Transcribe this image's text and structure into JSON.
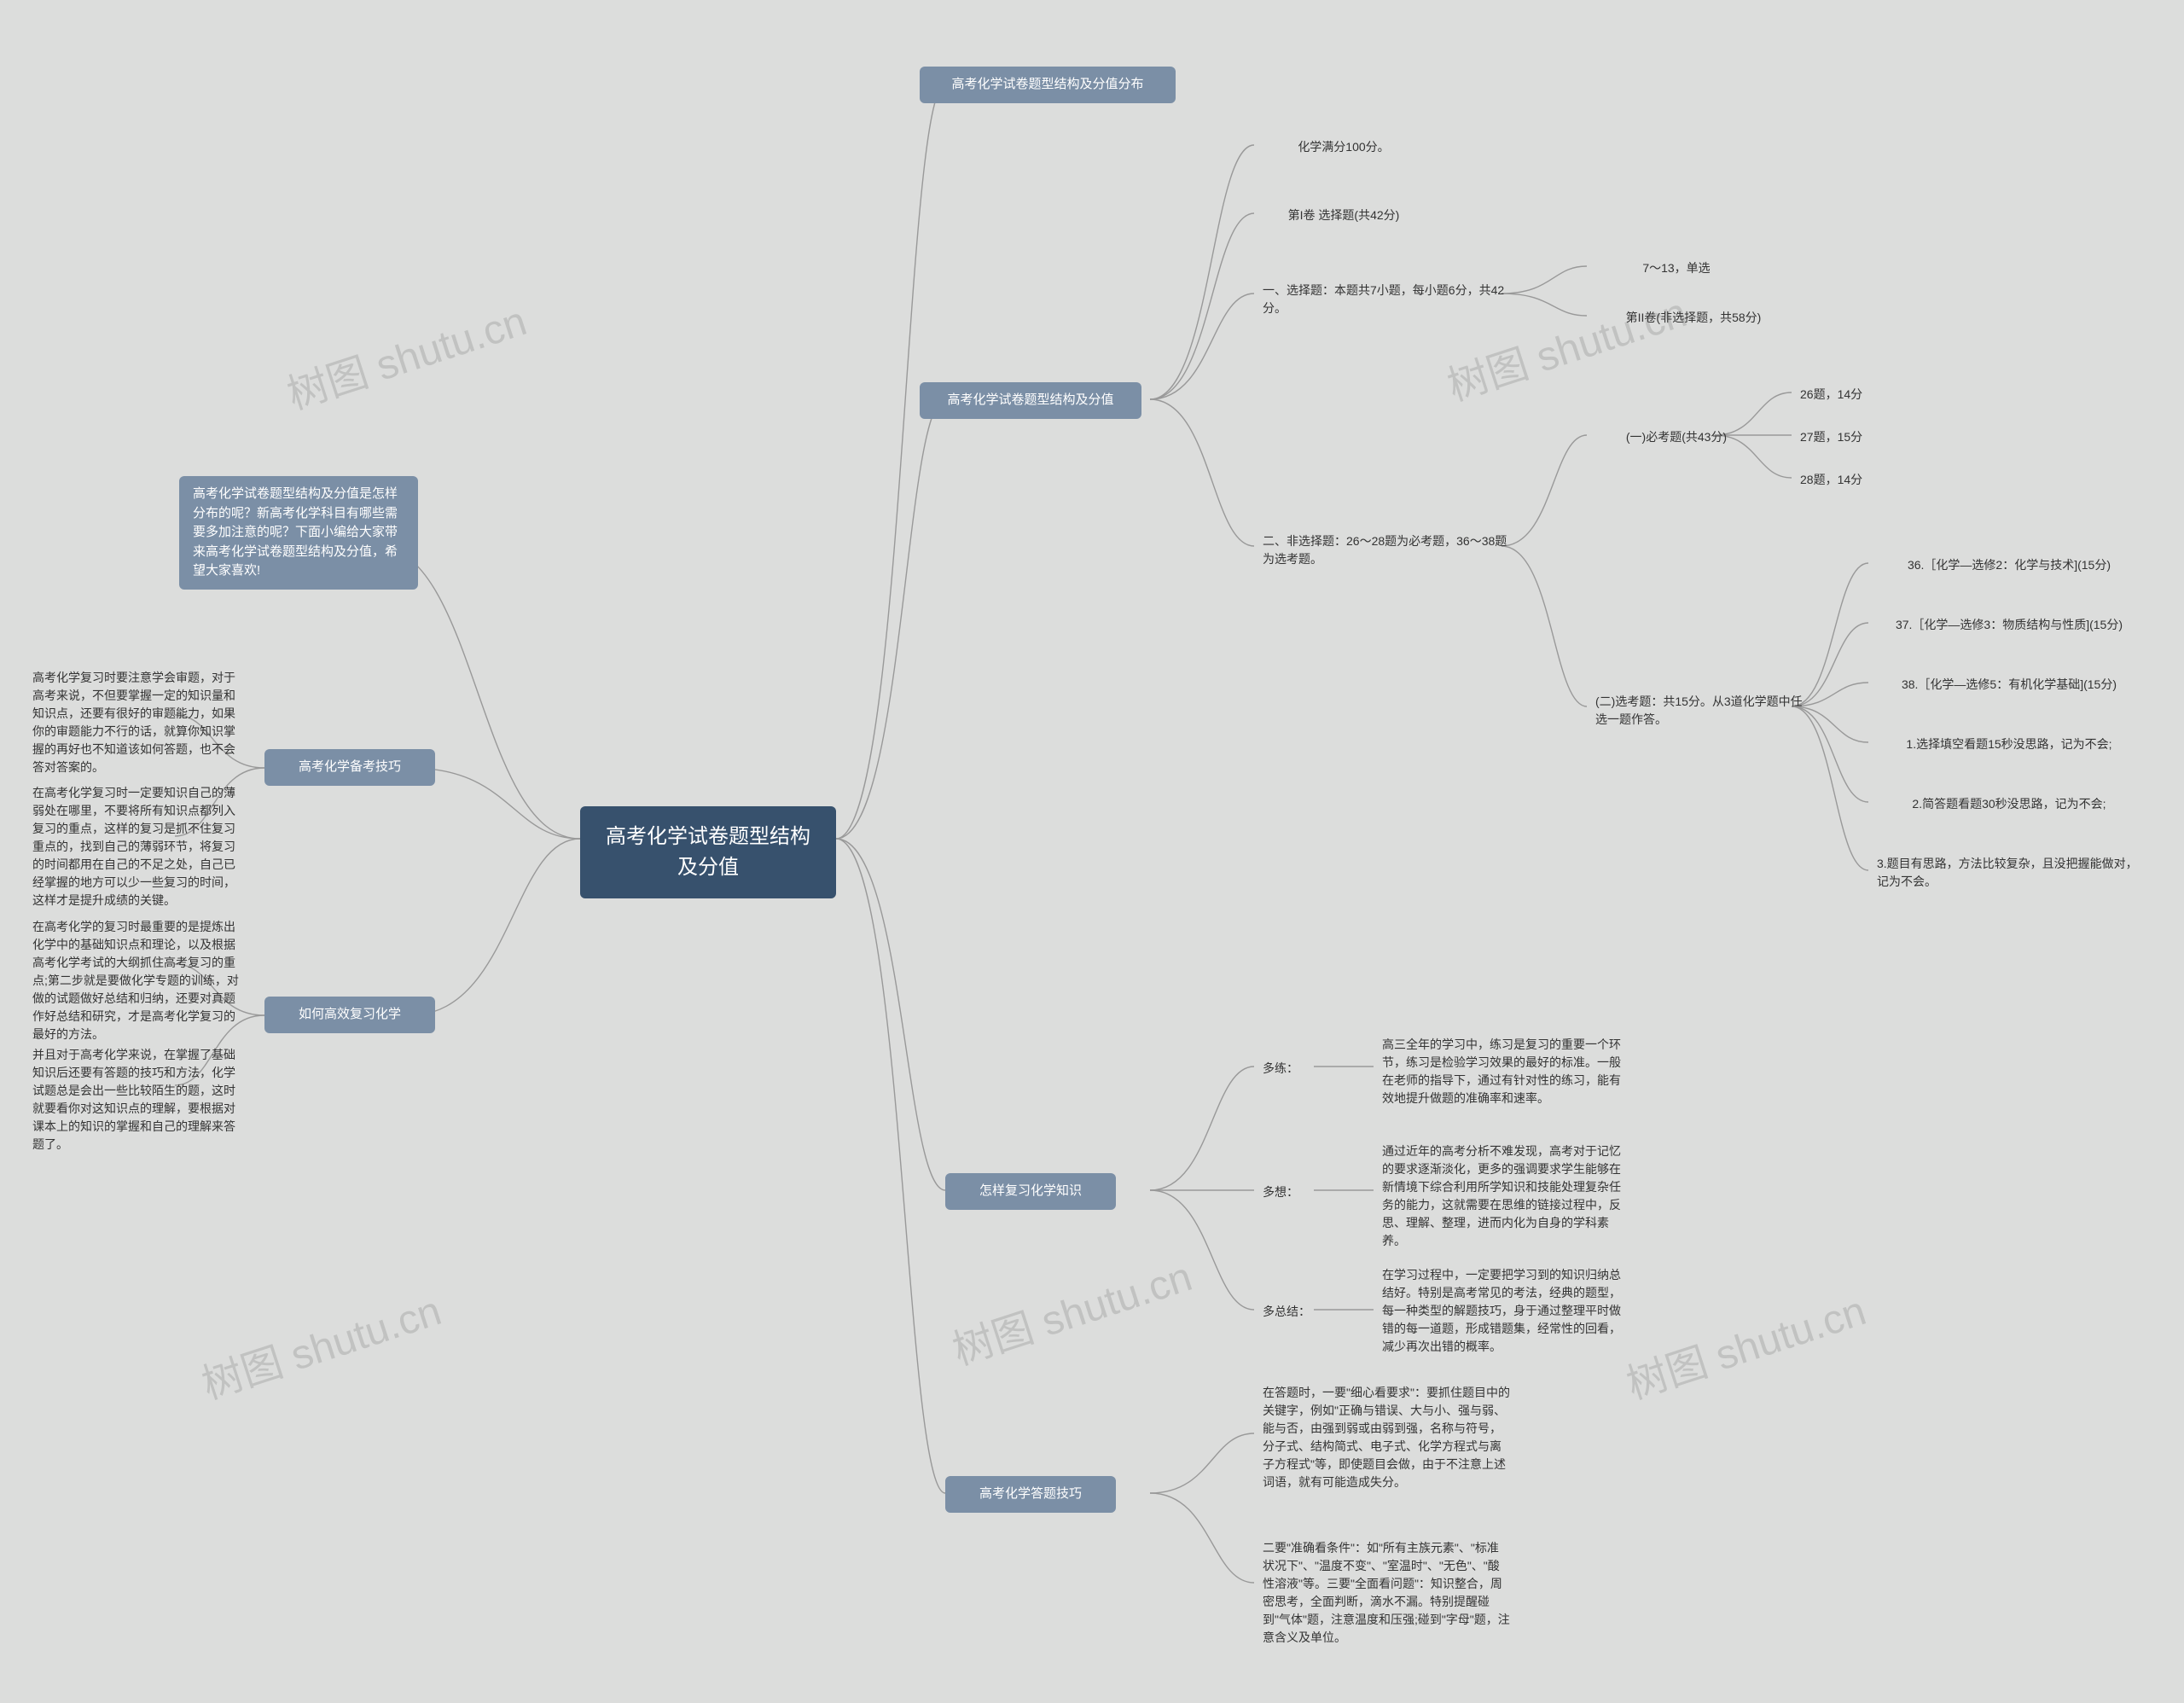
{
  "root": "高考化学试卷题型结构及分值",
  "left": {
    "intro": "高考化学试卷题型结构及分值是怎样分布的呢？新高考化学科目有哪些需要多加注意的呢？下面小编给大家带来高考化学试卷题型结构及分值，希望大家喜欢!",
    "beikao": {
      "title": "高考化学备考技巧",
      "a": "高考化学复习时要注意学会审题，对于高考来说，不但要掌握一定的知识量和知识点，还要有很好的审题能力，如果你的审题能力不行的话，就算你知识掌握的再好也不知道该如何答题，也不会答对答案的。",
      "b": "在高考化学复习时一定要知识自己的薄弱处在哪里，不要将所有知识点都列入复习的重点，这样的复习是抓不住复习重点的，找到自己的薄弱环节，将复习的时间都用在自己的不足之处，自己已经掌握的地方可以少一些复习的时间，这样才是提升成绩的关键。"
    },
    "gaoxiao": {
      "title": "如何高效复习化学",
      "a": "在高考化学的复习时最重要的是提炼出化学中的基础知识点和理论，以及根据高考化学考试的大纲抓住高考复习的重点;第二步就是要做化学专题的训练，对做的试题做好总结和归纳，还要对真题作好总结和研究，才是高考化学复习的最好的方法。",
      "b": "并且对于高考化学来说，在掌握了基础知识后还要有答题的技巧和方法，化学试题总是会出一些比较陌生的题，这时就要看你对这知识点的理解，要根据对课本上的知识的掌握和自己的理解来答题了。"
    }
  },
  "right": {
    "fenbu": "高考化学试卷题型结构及分值分布",
    "struct": {
      "title": "高考化学试卷题型结构及分值",
      "full": "化学满分100分。",
      "juan1": "第I卷 选择题(共42分)",
      "sec1": {
        "title": "一、选择题：本题共7小题，每小题6分，共42分。",
        "a": "7～13，单选",
        "b": "第II卷(非选择题，共58分)"
      },
      "sec2": {
        "title": "二、非选择题：26～28题为必考题，36～38题为选考题。",
        "bkt": {
          "title": "(一)必考题(共43分)",
          "a": "26题，14分",
          "b": "27题，15分",
          "c": "28题，14分"
        },
        "xkt": {
          "title": "(二)选考题：共15分。从3道化学题中任选一题作答。",
          "a": "36.［化学—选修2：化学与技术](15分)",
          "b": "37.［化学—选修3：物质结构与性质](15分)",
          "c": "38.［化学—选修5：有机化学基础](15分)",
          "d": "1.选择填空看题15秒没思路，记为不会;",
          "e": "2.简答题看题30秒没思路，记为不会;",
          "f": "3.题目有思路，方法比较复杂，且没把握能做对，记为不会。"
        }
      }
    },
    "fuxi": {
      "title": "怎样复习化学知识",
      "lian": {
        "k": "多练：",
        "v": "高三全年的学习中，练习是复习的重要一个环节，练习是检验学习效果的最好的标准。一般在老师的指导下，通过有针对性的练习，能有效地提升做题的准确率和速率。"
      },
      "xiang": {
        "k": "多想：",
        "v": "通过近年的高考分析不难发现，高考对于记忆的要求逐渐淡化，更多的强调要求学生能够在新情境下综合利用所学知识和技能处理复杂任务的能力，这就需要在思维的链接过程中，反思、理解、整理，进而内化为自身的学科素养。"
      },
      "zongjie": {
        "k": "多总结：",
        "v": "在学习过程中，一定要把学习到的知识归纳总结好。特别是高考常见的考法，经典的题型，每一种类型的解题技巧，身于通过整理平时做错的每一道题，形成错题集，经常性的回看，减少再次出错的概率。"
      }
    },
    "dati": {
      "title": "高考化学答题技巧",
      "a": "在答题时，一要\"细心看要求\"：要抓住题目中的关键字，例如\"正确与错误、大与小、强与弱、能与否，由强到弱或由弱到强，名称与符号，分子式、结构简式、电子式、化学方程式与离子方程式\"等，即使题目会做，由于不注意上述词语，就有可能造成失分。",
      "b": "二要\"准确看条件\"：如\"所有主族元素\"、\"标准状况下\"、\"温度不变\"、\"室温时\"、\"无色\"、\"酸性溶液\"等。三要\"全面看问题\"：知识整合，周密思考，全面判断，滴水不漏。特别提醒碰到\"气体\"题，注意温度和压强;碰到\"字母\"题，注意含义及单位。"
    }
  },
  "watermark": "树图 shutu.cn"
}
